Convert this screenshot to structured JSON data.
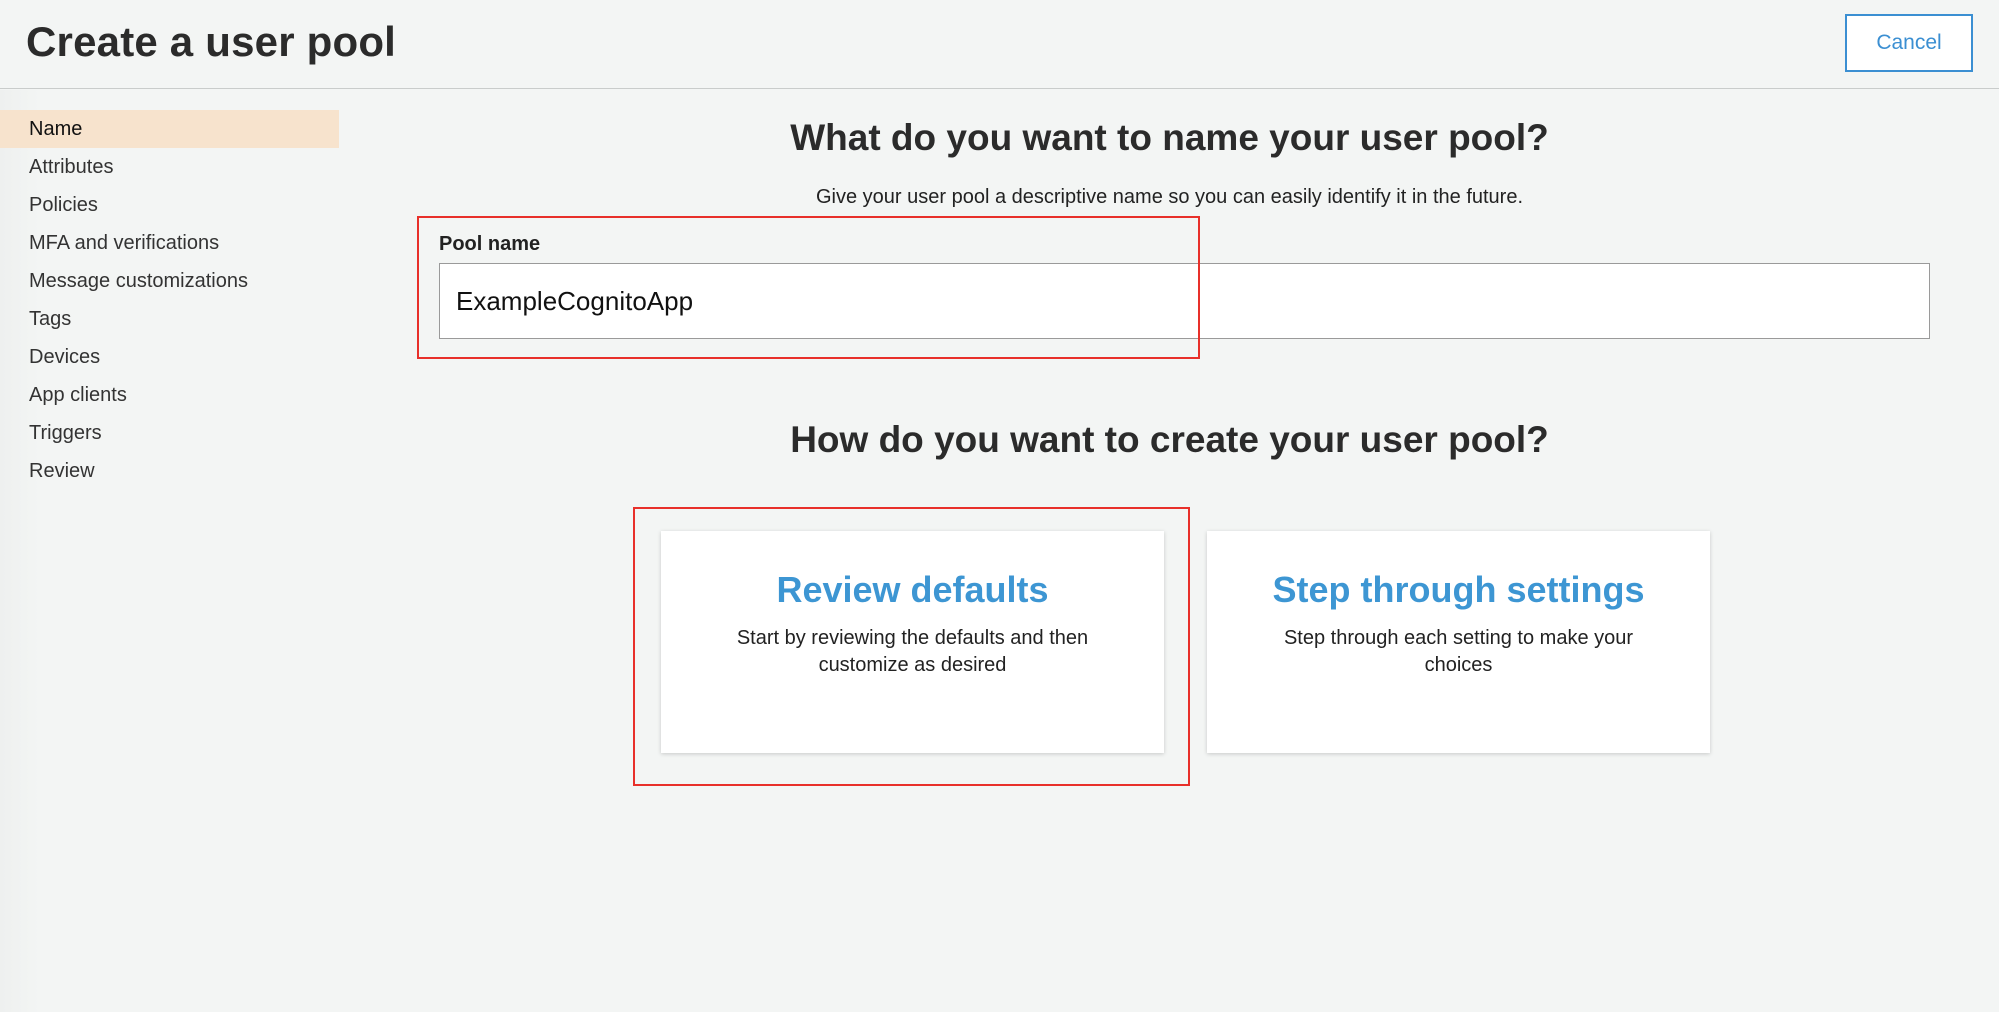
{
  "header": {
    "title": "Create a user pool",
    "cancel_label": "Cancel"
  },
  "sidebar": {
    "items": [
      {
        "label": "Name",
        "active": true
      },
      {
        "label": "Attributes"
      },
      {
        "label": "Policies"
      },
      {
        "label": "MFA and verifications"
      },
      {
        "label": "Message customizations"
      },
      {
        "label": "Tags"
      },
      {
        "label": "Devices"
      },
      {
        "label": "App clients"
      },
      {
        "label": "Triggers"
      },
      {
        "label": "Review"
      }
    ]
  },
  "main": {
    "name_heading": "What do you want to name your user pool?",
    "name_subtitle": "Give your user pool a descriptive name so you can easily identify it in the future.",
    "pool_name_label": "Pool name",
    "pool_name_value": "ExampleCognitoApp",
    "create_heading": "How do you want to create your user pool?",
    "options": [
      {
        "title": "Review defaults",
        "description": "Start by reviewing the defaults and then customize as desired"
      },
      {
        "title": "Step through settings",
        "description": "Step through each setting to make your choices"
      }
    ]
  },
  "colors": {
    "accent": "#3b8fd2",
    "active_nav": "#f7e3cd",
    "highlight": "#e8302a",
    "background": "#f3f5f4"
  }
}
